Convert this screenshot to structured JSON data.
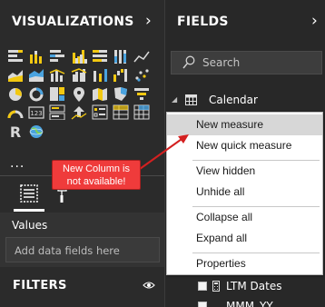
{
  "visualizations": {
    "title": "VISUALIZATIONS",
    "icons": [
      "stacked-bar-chart-icon",
      "stacked-column-chart-icon",
      "clustered-bar-chart-icon",
      "clustered-column-chart-icon",
      "100pct-stacked-bar-chart-icon",
      "100pct-stacked-column-chart-icon",
      "line-chart-icon",
      "area-chart-icon",
      "stacked-area-chart-icon",
      "line-and-stacked-column-chart-icon",
      "line-and-clustered-column-chart-icon",
      "ribbon-chart-icon",
      "waterfall-chart-icon",
      "scatter-chart-icon",
      "pie-chart-icon",
      "donut-chart-icon",
      "treemap-icon",
      "map-icon",
      "filled-map-icon",
      "shape-map-icon",
      "funnel-chart-icon",
      "gauge-icon",
      "card-icon",
      "multi-row-card-icon",
      "kpi-icon",
      "slicer-icon",
      "table-visual-icon",
      "matrix-icon",
      "r-script-visual-icon",
      "globe-map-icon"
    ],
    "r_glyph": "R",
    "more": "...",
    "values_label": "Values",
    "drop_placeholder": "Add data fields here",
    "filters_title": "FILTERS"
  },
  "fields": {
    "title": "FIELDS",
    "search_placeholder": "Search",
    "table_name": "Calendar",
    "rows": [
      {
        "label": "LTM Dates"
      },
      {
        "label": "MMM_YY"
      }
    ]
  },
  "context_menu": {
    "items": [
      {
        "label": "New measure",
        "highlighted": true
      },
      {
        "label": "New quick measure",
        "highlighted": false
      },
      {
        "label": "View hidden",
        "highlighted": false
      },
      {
        "label": "Unhide all",
        "highlighted": false
      },
      {
        "label": "Collapse all",
        "highlighted": false
      },
      {
        "label": "Expand all",
        "highlighted": false
      },
      {
        "label": "Properties",
        "highlighted": false
      }
    ]
  },
  "callout": {
    "line1": "New Column is",
    "line2": "not available!"
  },
  "colors": {
    "pane_bg": "#2b2b2b",
    "callout_red": "#ef3b3b",
    "icon_yellow": "#f2c811",
    "icon_blue": "#4aa3df",
    "icon_light": "#d9d9d9"
  }
}
